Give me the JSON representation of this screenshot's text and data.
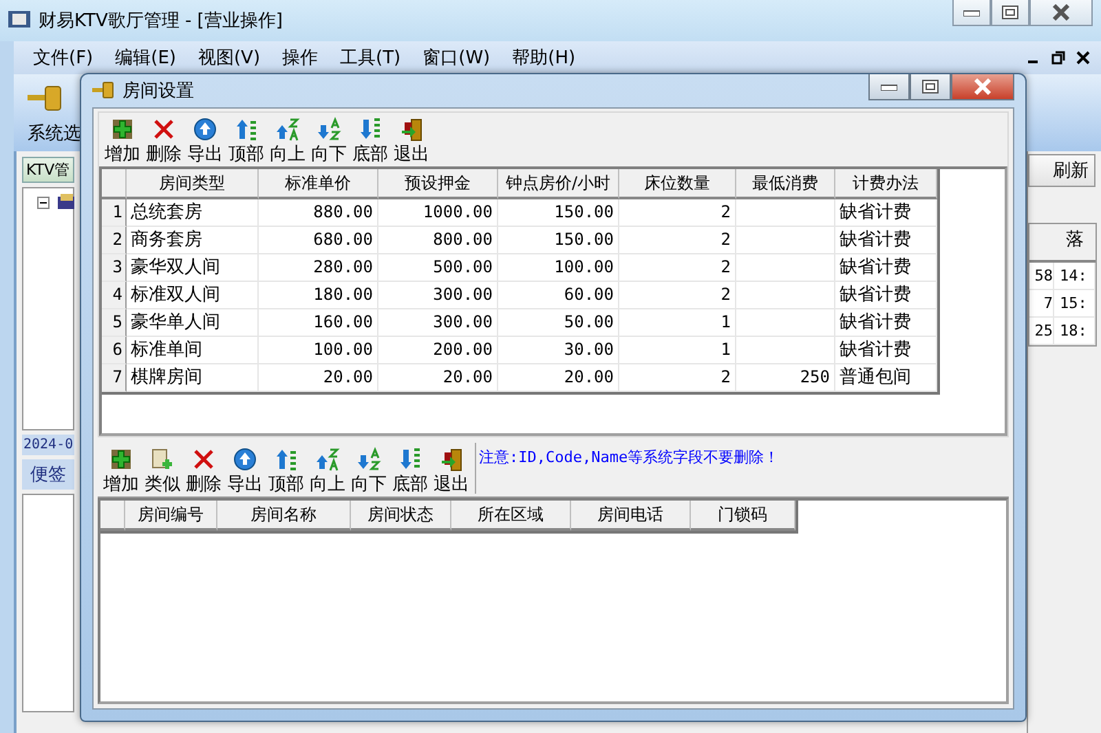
{
  "window": {
    "title": "财易KTV歌厅管理 - [营业操作]"
  },
  "menu": [
    "文件(F)",
    "编辑(E)",
    "视图(V)",
    "操作",
    "工具(T)",
    "窗口(W)",
    "帮助(H)"
  ],
  "main_toolbar": [
    {
      "label": "系统选"
    }
  ],
  "left_panel": {
    "tab": "KTV管",
    "date": "2024-0",
    "notes_tab": "便签"
  },
  "right_panel": {
    "refresh": "刷新",
    "column_2": "落",
    "rows": [
      [
        "58",
        "14:"
      ],
      [
        "7",
        "15:"
      ],
      [
        "25",
        "18:"
      ]
    ]
  },
  "dialog": {
    "title": "房间设置",
    "toolbar": [
      {
        "kind": "add",
        "label": "增加"
      },
      {
        "kind": "delete",
        "label": "删除"
      },
      {
        "kind": "export",
        "label": "导出"
      },
      {
        "kind": "top",
        "label": "顶部"
      },
      {
        "kind": "up",
        "label": "向上"
      },
      {
        "kind": "down",
        "label": "向下"
      },
      {
        "kind": "bottom",
        "label": "底部"
      },
      {
        "kind": "exit",
        "label": "退出"
      }
    ],
    "room_types": {
      "columns": [
        "房间类型",
        "标准单价",
        "预设押金",
        "钟点房价/小时",
        "床位数量",
        "最低消费",
        "计费办法"
      ],
      "rows": [
        {
          "number": "1",
          "cells": [
            "总统套房",
            "880.00",
            "1000.00",
            "150.00",
            "2",
            "",
            "缺省计费"
          ]
        },
        {
          "number": "2",
          "cells": [
            "商务套房",
            "680.00",
            "800.00",
            "150.00",
            "2",
            "",
            "缺省计费"
          ]
        },
        {
          "number": "3",
          "cells": [
            "豪华双人间",
            "280.00",
            "500.00",
            "100.00",
            "2",
            "",
            "缺省计费"
          ]
        },
        {
          "number": "4",
          "cells": [
            "标准双人间",
            "180.00",
            "300.00",
            "60.00",
            "2",
            "",
            "缺省计费"
          ]
        },
        {
          "number": "5",
          "cells": [
            "豪华单人间",
            "160.00",
            "300.00",
            "50.00",
            "1",
            "",
            "缺省计费"
          ]
        },
        {
          "number": "6",
          "cells": [
            "标准单间",
            "100.00",
            "200.00",
            "30.00",
            "1",
            "",
            "缺省计费"
          ]
        },
        {
          "number": "7",
          "cells": [
            "棋牌房间",
            "20.00",
            "20.00",
            "20.00",
            "2",
            "250",
            "普通包间"
          ]
        }
      ]
    },
    "toolbar_2": [
      {
        "kind": "add",
        "label": "增加"
      },
      {
        "kind": "copy",
        "label": "类似"
      },
      {
        "kind": "delete",
        "label": "删除"
      },
      {
        "kind": "export",
        "label": "导出"
      },
      {
        "kind": "top",
        "label": "顶部"
      },
      {
        "kind": "up",
        "label": "向上"
      },
      {
        "kind": "down",
        "label": "向下"
      },
      {
        "kind": "bottom",
        "label": "底部"
      },
      {
        "kind": "exit",
        "label": "退出"
      }
    ],
    "note": "注意:ID,Code,Name等系统字段不要删除！",
    "rooms": {
      "columns": [
        "房间编号",
        "房间名称",
        "房间状态",
        "所在区域",
        "房间电话",
        "门锁码"
      ]
    }
  }
}
